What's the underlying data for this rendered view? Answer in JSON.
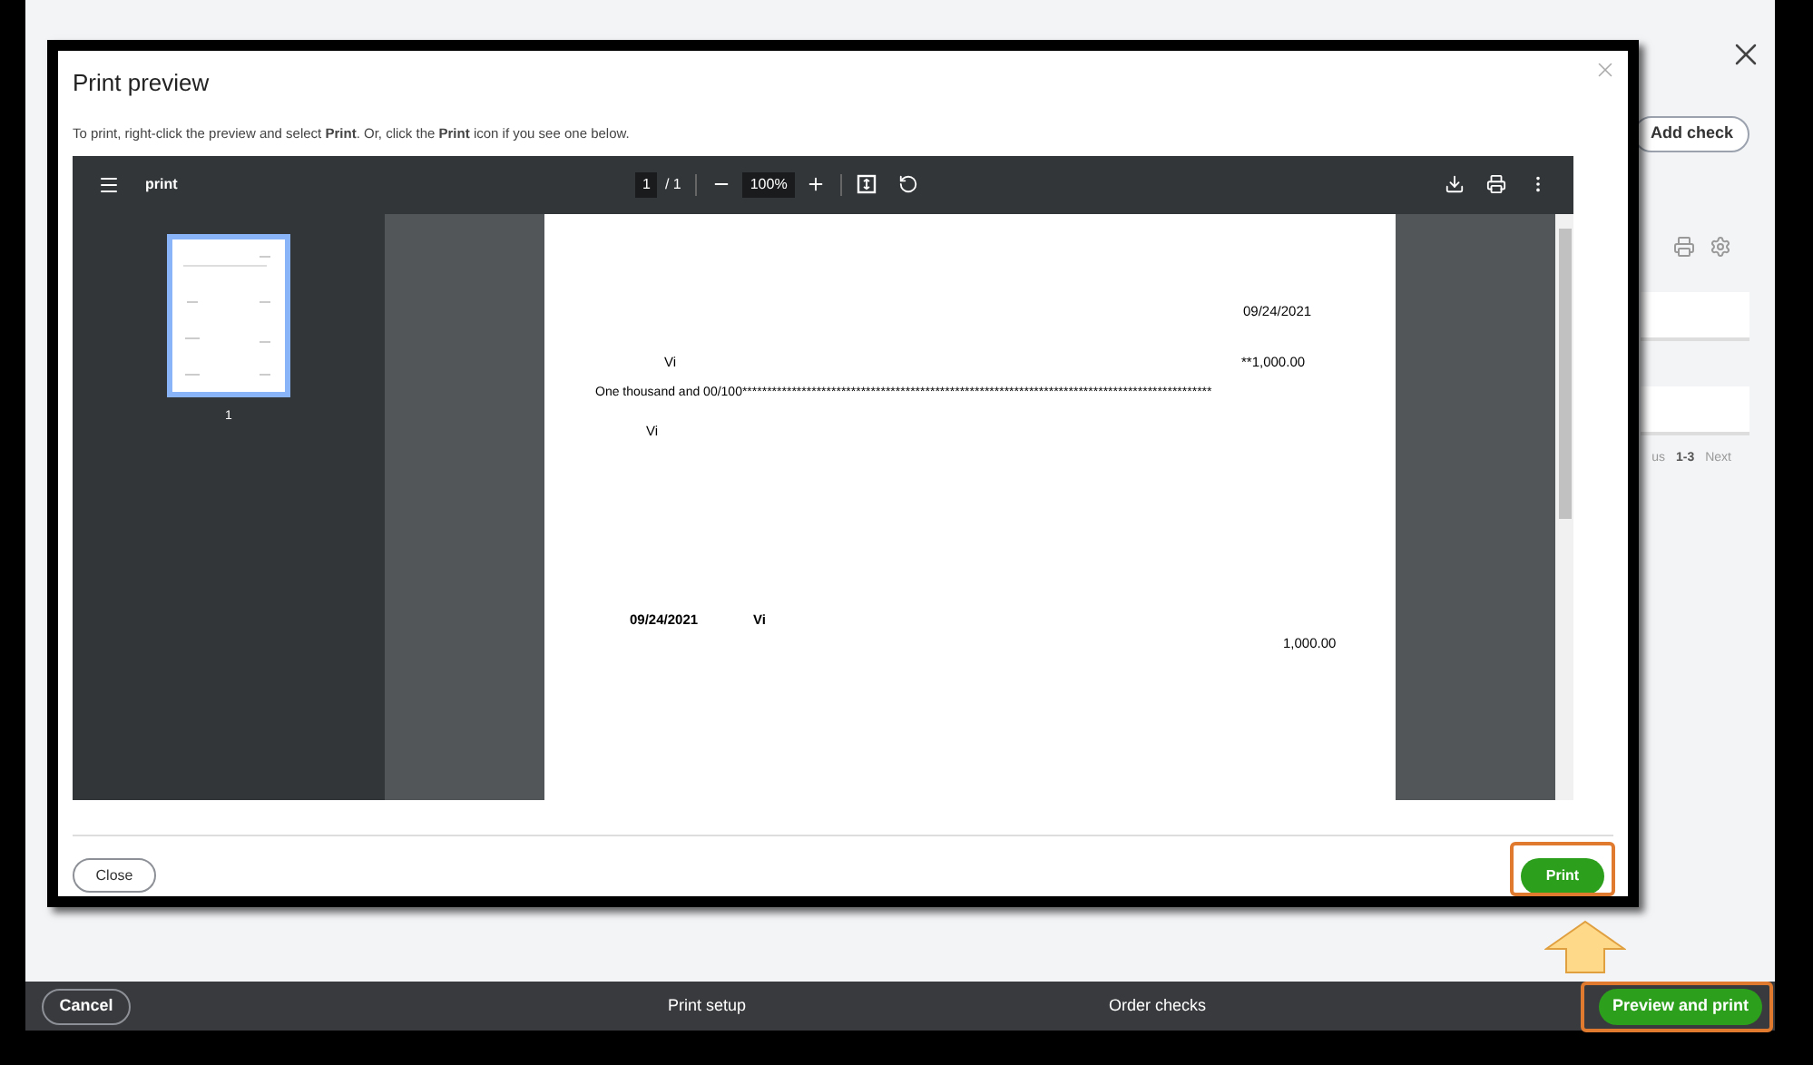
{
  "background_page": {
    "add_check": "Add check",
    "pagination": {
      "previous": "us",
      "range": "1-3",
      "next": "Next"
    }
  },
  "footer": {
    "cancel": "Cancel",
    "print_setup": "Print setup",
    "order_checks": "Order checks",
    "preview_and_print": "Preview and print"
  },
  "dialog": {
    "title": "Print preview",
    "instruction": "To print, right-click the preview and select **Print**. Or, click the **Print** icon if you see one below.",
    "viewer": {
      "file_name": "print",
      "page_current": "1",
      "page_total": "/ 1",
      "zoom": "100%",
      "thumbnail_label": "1",
      "page": {
        "date": "09/24/2021",
        "payee": "Vi",
        "amount": "**1,000.00",
        "amount_words": "One thousand and 00/100***********************************************************************************************",
        "address": "Vi",
        "stub_date": "09/24/2021",
        "stub_payee": "Vi",
        "stub_amount": "1,000.00"
      }
    },
    "close": "Close",
    "print": "Print"
  }
}
